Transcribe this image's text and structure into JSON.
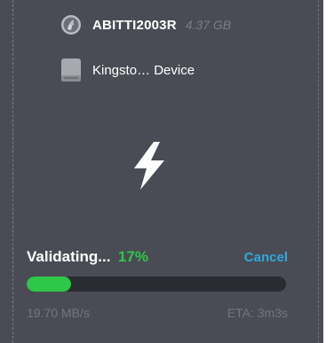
{
  "image": {
    "name": "ABITTI2003R",
    "size": "4.37 GB",
    "icon": "disc-image-icon"
  },
  "drive": {
    "name": "Kingsto… Device",
    "icon": "drive-icon"
  },
  "flash": {
    "icon": "lightning-bolt-icon"
  },
  "status": {
    "label": "Validating...",
    "percent_text": "17%",
    "progress": 0.17,
    "cancel_label": "Cancel",
    "speed": "19.70 MB/s",
    "eta": "ETA: 3m3s"
  },
  "colors": {
    "background": "#4a4c55",
    "accent_green": "#2ec747",
    "link_blue": "#2ea8d9",
    "muted_text": "#74767f",
    "track": "#2b2c31"
  }
}
